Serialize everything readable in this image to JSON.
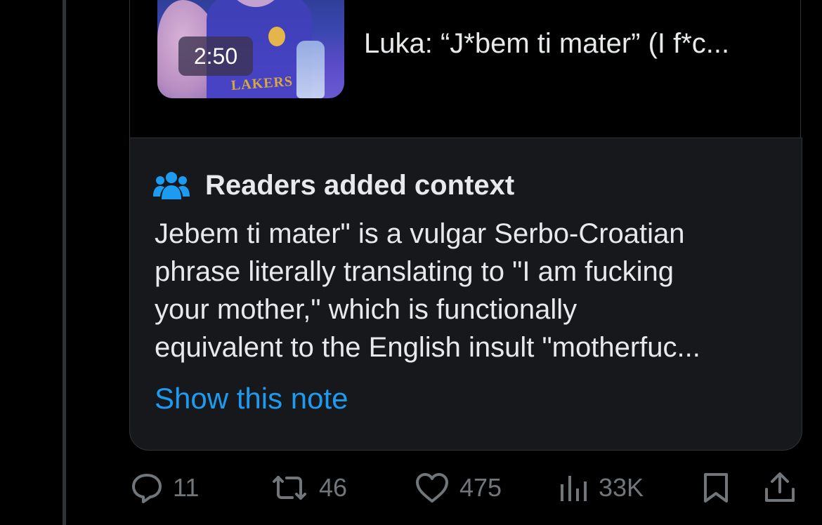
{
  "media": {
    "duration": "2:50",
    "title": "Luka: “J*bem ti mater” (I f*c...",
    "jersey_text": "LAKERS"
  },
  "note": {
    "header_icon": "people-icon",
    "title": "Readers added context",
    "body_lines": [
      "Jebem ti mater\" is a vulgar Serbo-Croatian",
      "phrase literally translating to \"I am fucking",
      "your mother,\" which is functionally",
      "equivalent to the English insult \"motherfuc..."
    ],
    "show_label": "Show this note"
  },
  "actions": {
    "replies": {
      "icon": "reply-icon",
      "count": "11"
    },
    "reposts": {
      "icon": "repost-icon",
      "count": "46"
    },
    "likes": {
      "icon": "heart-icon",
      "count": "475"
    },
    "views": {
      "icon": "views-icon",
      "count": "33K"
    },
    "bookmark": {
      "icon": "bookmark-icon"
    },
    "share": {
      "icon": "share-icon"
    }
  },
  "colors": {
    "background": "#000000",
    "note_background": "#16181c",
    "border": "#2f3336",
    "text": "#e7e9ea",
    "muted": "#71767b",
    "link": "#1d9bf0"
  }
}
